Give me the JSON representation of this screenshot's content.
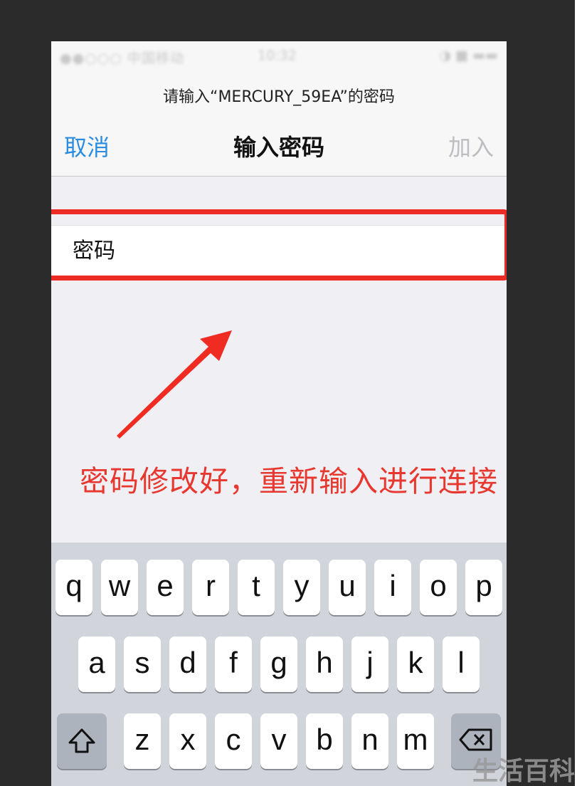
{
  "status_bar": {
    "carrier": "●●○○○ 中国移动 ",
    "time": "10:32",
    "indicators": "◑ ■ ▬▬"
  },
  "dialog": {
    "prompt": "请输入“MERCURY_59EA”的密码",
    "cancel_label": "取消",
    "title": "输入密码",
    "join_label": "加入"
  },
  "password_field": {
    "placeholder": "密码",
    "value": ""
  },
  "annotation": {
    "text": "密码修改好，重新输入进行连接",
    "color": "#e8372f"
  },
  "keyboard": {
    "row1": [
      "q",
      "w",
      "e",
      "r",
      "t",
      "y",
      "u",
      "i",
      "o",
      "p"
    ],
    "row2": [
      "a",
      "s",
      "d",
      "f",
      "g",
      "h",
      "j",
      "k",
      "l"
    ],
    "row3": [
      "z",
      "x",
      "c",
      "v",
      "b",
      "n",
      "m"
    ],
    "shift_icon": "shift-icon",
    "delete_icon": "backspace-icon"
  },
  "watermark": "生活百科",
  "colors": {
    "accent": "#2a8de0",
    "highlight": "#ee2a24"
  }
}
